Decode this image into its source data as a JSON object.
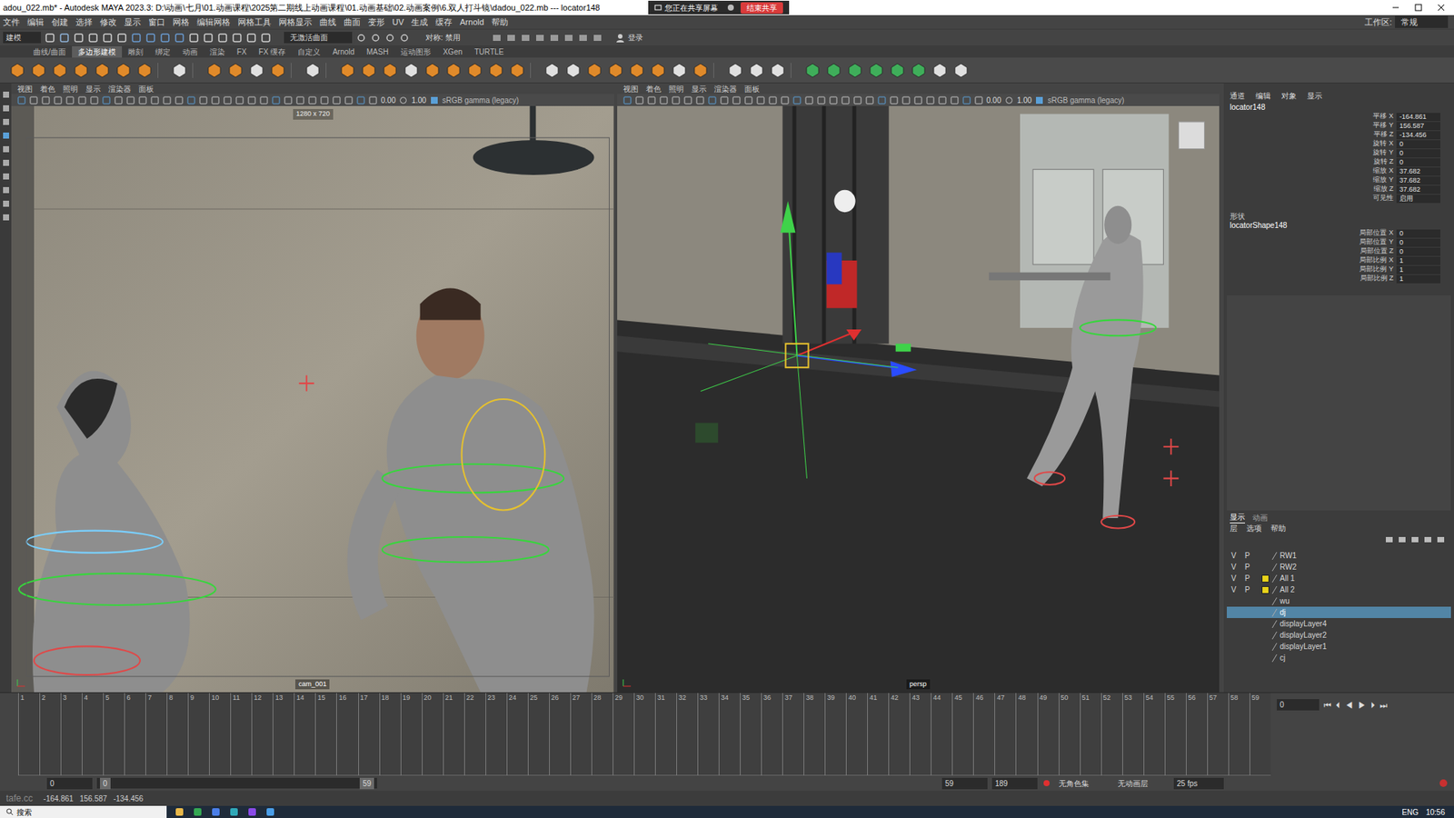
{
  "window": {
    "title": "adou_022.mb* - Autodesk MAYA 2023.3: D:\\动画\\七月\\01.动画课程\\2025第二期线上动画课程\\01.动画基础\\02.动画案例\\6.双人打斗镜\\dadou_022.mb --- locator148",
    "share_notice": "您正在共享屏幕",
    "share_stop": "结束共享"
  },
  "menu": [
    "文件",
    "编辑",
    "创建",
    "选择",
    "修改",
    "显示",
    "窗口",
    "网格",
    "编辑网格",
    "网格工具",
    "网格显示",
    "曲线",
    "曲面",
    "变形",
    "UV",
    "生成",
    "缓存",
    "Arnold",
    "帮助"
  ],
  "workspace": {
    "label": "工作区:",
    "value": "常规"
  },
  "status_line": {
    "mode": "建模",
    "surface": "无激活曲面",
    "symmetry": "对称: 禁用",
    "login": "登录"
  },
  "shelf": {
    "tabs": [
      {
        "label": "曲线/曲面",
        "selected": false
      },
      {
        "label": "多边形建模",
        "selected": true
      },
      {
        "label": "雕刻",
        "selected": false
      },
      {
        "label": "绑定",
        "selected": false
      },
      {
        "label": "动画",
        "selected": false
      },
      {
        "label": "渲染",
        "selected": false
      },
      {
        "label": "FX",
        "selected": false
      },
      {
        "label": "FX 缓存",
        "selected": false
      },
      {
        "label": "自定义",
        "selected": false
      },
      {
        "label": "Arnold",
        "selected": false
      },
      {
        "label": "MASH",
        "selected": false
      },
      {
        "label": "运动图形",
        "selected": false
      },
      {
        "label": "XGen",
        "selected": false
      },
      {
        "label": "TURTLE",
        "selected": false
      }
    ]
  },
  "viewports": [
    {
      "menu": [
        "视图",
        "着色",
        "照明",
        "显示",
        "渲染器",
        "面板"
      ],
      "exposure": "0.00",
      "gamma": "1.00",
      "colorspace": "sRGB gamma (legacy)",
      "resolution": "1280 x 720",
      "camera": "cam_001"
    },
    {
      "menu": [
        "视图",
        "着色",
        "照明",
        "显示",
        "渲染器",
        "面板"
      ],
      "exposure": "0.00",
      "gamma": "1.00",
      "colorspace": "sRGB gamma (legacy)",
      "resolution": "",
      "camera": "persp"
    }
  ],
  "channel_box": {
    "tabs": [
      "通道",
      "编辑",
      "对象",
      "显示"
    ],
    "object": "locator148",
    "attributes": [
      {
        "label": "平移 X",
        "value": "-164.861"
      },
      {
        "label": "平移 Y",
        "value": "156.587"
      },
      {
        "label": "平移 Z",
        "value": "-134.456"
      },
      {
        "label": "旋转 X",
        "value": "0"
      },
      {
        "label": "旋转 Y",
        "value": "0"
      },
      {
        "label": "旋转 Z",
        "value": "0"
      },
      {
        "label": "缩放 X",
        "value": "37.682"
      },
      {
        "label": "缩放 Y",
        "value": "37.682"
      },
      {
        "label": "缩放 Z",
        "value": "37.682"
      },
      {
        "label": "可见性",
        "value": "启用"
      }
    ],
    "shapes_label": "形状",
    "shape": "locatorShape148",
    "shape_attributes": [
      {
        "label": "局部位置 X",
        "value": "0"
      },
      {
        "label": "局部位置 Y",
        "value": "0"
      },
      {
        "label": "局部位置 Z",
        "value": "0"
      },
      {
        "label": "局部比例 X",
        "value": "1"
      },
      {
        "label": "局部比例 Y",
        "value": "1"
      },
      {
        "label": "局部比例 Z",
        "value": "1"
      }
    ]
  },
  "layers": {
    "tabs": [
      {
        "label": "显示",
        "selected": true
      },
      {
        "label": "动画",
        "selected": false
      }
    ],
    "menu": [
      "层",
      "选项",
      "帮助"
    ],
    "items": [
      {
        "name": "RW1",
        "v": "V",
        "p": "P",
        "color": null,
        "selected": false
      },
      {
        "name": "RW2",
        "v": "V",
        "p": "P",
        "color": null,
        "selected": false
      },
      {
        "name": "All 1",
        "v": "V",
        "p": "P",
        "color": "#e8d21a",
        "selected": false
      },
      {
        "name": "All 2",
        "v": "V",
        "p": "P",
        "color": "#e8d21a",
        "selected": false
      },
      {
        "name": "wu",
        "v": "",
        "p": "",
        "color": null,
        "selected": false
      },
      {
        "name": "dj",
        "v": "",
        "p": "",
        "color": null,
        "selected": true
      },
      {
        "name": "displayLayer4",
        "v": "",
        "p": "",
        "color": null,
        "selected": false
      },
      {
        "name": "displayLayer2",
        "v": "",
        "p": "",
        "color": null,
        "selected": false
      },
      {
        "name": "displayLayer1",
        "v": "",
        "p": "",
        "color": null,
        "selected": false
      },
      {
        "name": "cj",
        "v": "",
        "p": "",
        "color": null,
        "selected": false
      }
    ]
  },
  "timeline": {
    "ticks": [
      "1",
      "2",
      "3",
      "4",
      "5",
      "6",
      "7",
      "8",
      "9",
      "10",
      "11",
      "12",
      "13",
      "14",
      "15",
      "16",
      "17",
      "18",
      "19",
      "20",
      "21",
      "22",
      "23",
      "24",
      "25",
      "26",
      "27",
      "28",
      "29",
      "30",
      "31",
      "32",
      "33",
      "34",
      "35",
      "36",
      "37",
      "38",
      "39",
      "40",
      "41",
      "42",
      "43",
      "44",
      "45",
      "46",
      "47",
      "48",
      "49",
      "50",
      "51",
      "52",
      "53",
      "54",
      "55",
      "56",
      "57",
      "58",
      "59"
    ],
    "current": "0",
    "controls": [
      "⏮",
      "⏴",
      "◀",
      "▶",
      "⏵",
      "⏭"
    ]
  },
  "range": {
    "start": "0",
    "inner_start": "0",
    "inner_end": "59",
    "end": "59",
    "max": "189",
    "character_set": "无角色集",
    "anim_layer": "无动画层",
    "fps": "25 fps"
  },
  "command_line": {
    "watermark": "tafe.cc",
    "readout": "-164.861   156.587   -134.456"
  },
  "taskbar": {
    "search": "搜索",
    "lang": "ENG",
    "time": "10:56"
  }
}
